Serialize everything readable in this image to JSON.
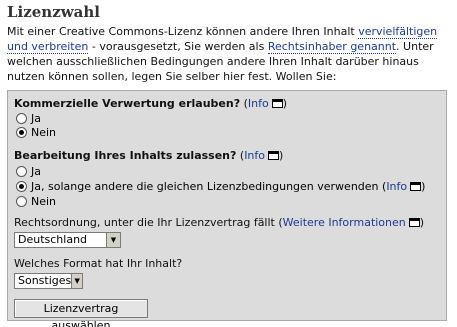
{
  "heading": "Lizenzwahl",
  "intro": {
    "part1": "Mit einer Creative Commons-Lizenz können andere Ihren Inhalt ",
    "link1": "vervielfältigen und verbreiten",
    "part2": " - vorausgesetzt, Sie werden als ",
    "link2": "Rechtsinhaber genannt",
    "part3": ". Unter welchen ausschließlichen Bedingungen andere Ihren Inhalt darüber hinaus nutzen können sollen, legen Sie selber hier fest. Wollen Sie:"
  },
  "commercial": {
    "question": "Kommerzielle Verwertung erlauben?",
    "open_paren": " (",
    "info_label": "Info",
    "close_paren": ")",
    "options": [
      {
        "label": "Ja",
        "checked": false
      },
      {
        "label": "Nein",
        "checked": true
      }
    ]
  },
  "modification": {
    "question": "Bearbeitung Ihres Inhalts zulassen?",
    "open_paren": " (",
    "info_label": "Info",
    "close_paren": ")",
    "options": [
      {
        "label": "Ja",
        "checked": false
      },
      {
        "label": "Ja, solange andere die gleichen Lizenzbedingungen verwenden (",
        "info_label": "Info",
        "close_paren": ")",
        "checked": true
      },
      {
        "label": "Nein",
        "checked": false
      }
    ]
  },
  "jurisdiction": {
    "label": "Rechtsordnung, unter die Ihr Lizenzvertrag fällt (",
    "link_label": "Weitere Informationen",
    "close_paren": ")",
    "selected": "Deutschland"
  },
  "format": {
    "label": "Welches Format hat Ihr Inhalt?",
    "selected": "Sonstiges"
  },
  "submit_label": "Lizenzvertrag auswählen",
  "icons": {
    "popup": "new-window-icon",
    "dropdown": "chevron-down-icon"
  },
  "colors": {
    "link": "#1a3b8f",
    "panel_bg": "#dcdcdc",
    "heading": "#333333"
  }
}
